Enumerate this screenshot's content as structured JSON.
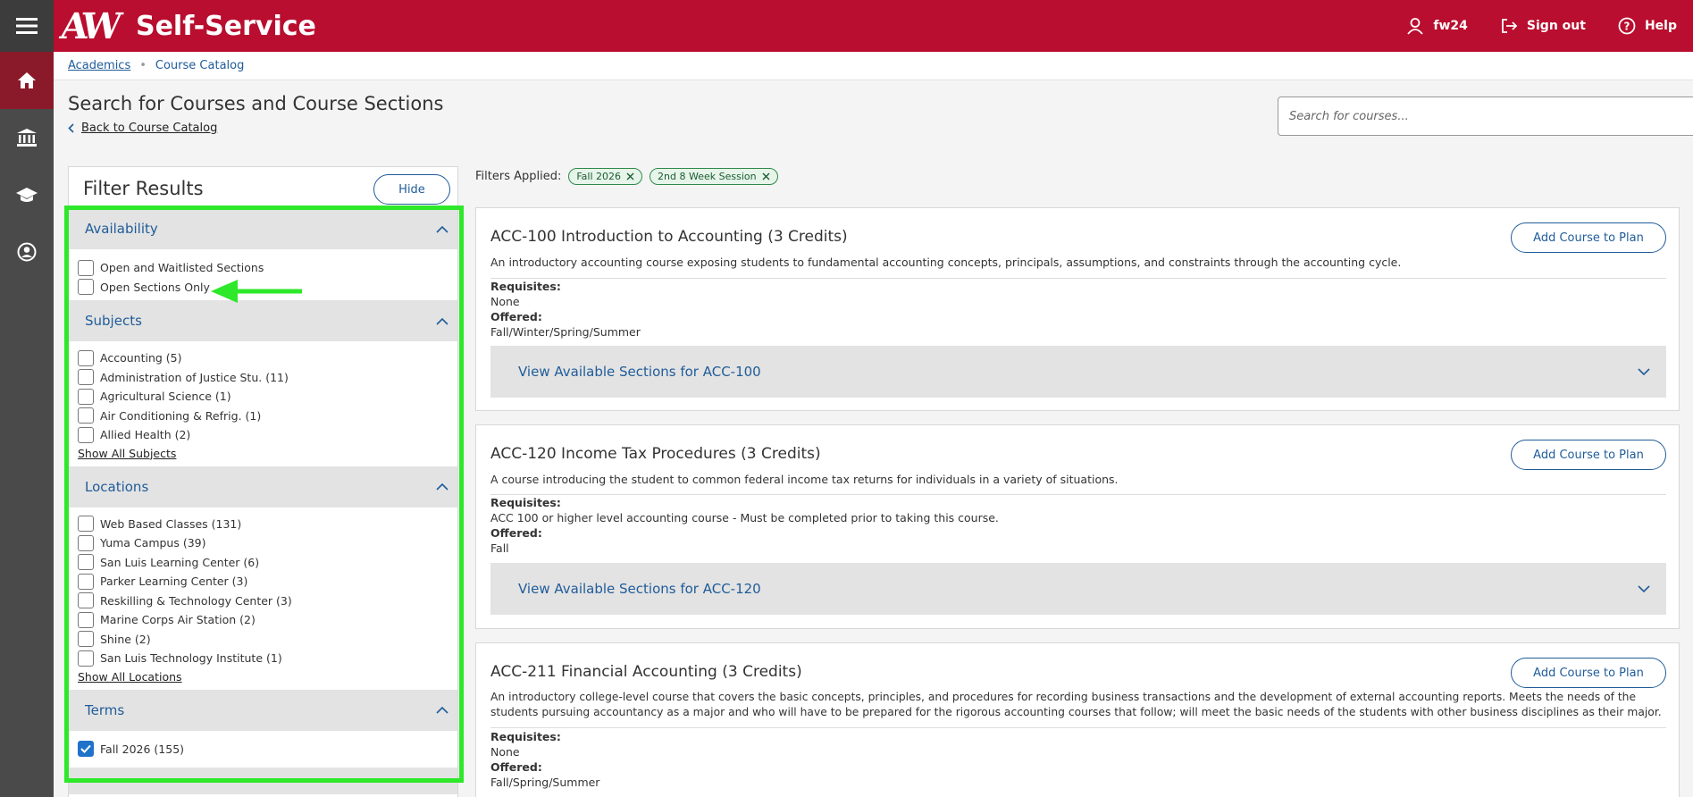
{
  "header": {
    "app_title": "Self-Service",
    "logo_mark": "AW",
    "user": "fw24",
    "sign_out": "Sign out",
    "help": "Help"
  },
  "breadcrumb": {
    "items": [
      "Academics",
      "Course Catalog"
    ]
  },
  "page": {
    "title": "Search for Courses and Course Sections",
    "back_link": "Back to Course Catalog",
    "search_placeholder": "Search for courses..."
  },
  "filter": {
    "title": "Filter Results",
    "hide": "Hide",
    "groups": [
      {
        "title": "Availability",
        "options": [
          "Open and Waitlisted Sections",
          "Open Sections Only"
        ]
      },
      {
        "title": "Subjects",
        "options": [
          "Accounting (5)",
          "Administration of Justice Stu. (11)",
          "Agricultural Science (1)",
          "Air Conditioning & Refrig. (1)",
          "Allied Health (2)"
        ],
        "show_all": "Show All Subjects"
      },
      {
        "title": "Locations",
        "options": [
          "Web Based Classes (131)",
          "Yuma Campus (39)",
          "San Luis Learning Center (6)",
          "Parker Learning Center (3)",
          "Reskilling & Technology Center (3)",
          "Marine Corps Air Station (2)",
          "Shine (2)",
          "San Luis Technology Institute (1)"
        ],
        "show_all": "Show All Locations"
      },
      {
        "title": "Terms",
        "options": [
          "Fall 2026 (155)"
        ]
      }
    ]
  },
  "applied": {
    "label": "Filters Applied:",
    "chips": [
      "Fall 2026",
      "2nd 8 Week Session"
    ]
  },
  "courses": [
    {
      "title": "ACC-100 Introduction to Accounting (3 Credits)",
      "add": "Add Course to Plan",
      "description": "An introductory accounting course exposing students to fundamental accounting concepts, principals, assumptions, and constraints through the accounting cycle.",
      "requisites_label": "Requisites:",
      "requisites": "None",
      "offered_label": "Offered:",
      "offered": "Fall/Winter/Spring/Summer",
      "view": "View Available Sections for ACC-100"
    },
    {
      "title": "ACC-120 Income Tax Procedures (3 Credits)",
      "add": "Add Course to Plan",
      "description": "A course introducing the student to common federal income tax returns for individuals in a variety of situations.",
      "requisites_label": "Requisites:",
      "requisites": "ACC 100 or higher level accounting course - Must be completed prior to taking this course.",
      "offered_label": "Offered:",
      "offered": "Fall",
      "view": "View Available Sections for ACC-120"
    },
    {
      "title": "ACC-211 Financial Accounting (3 Credits)",
      "add": "Add Course to Plan",
      "description": "An introductory college-level course that covers the basic concepts, principles, and procedures for recording business transactions and the development of external accounting reports. Meets the needs of the students pursuing accountancy as a major and who will have to be prepared for the rigorous accounting courses that follow; will meet the basic needs of the students with other business disciplines as their major.",
      "requisites_label": "Requisites:",
      "requisites": "None",
      "offered_label": "Offered:",
      "offered": "Fall/Spring/Summer"
    }
  ],
  "colors": {
    "brand": "#b90e2f",
    "link": "#1f5c99",
    "highlight": "#2ee82a",
    "rail": "#4a4a4a"
  }
}
